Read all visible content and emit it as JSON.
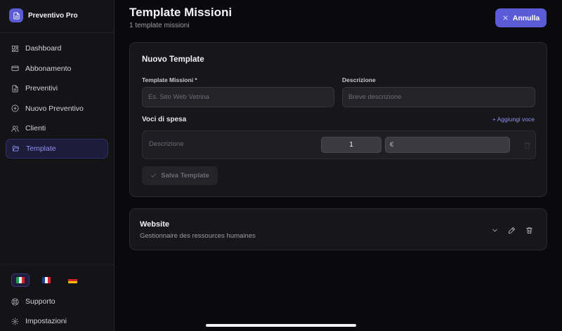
{
  "brand": {
    "name": "Preventivo Pro",
    "logo_icon": "document-icon",
    "accent": "#5b5bd6"
  },
  "sidebar": {
    "items": [
      {
        "label": "Dashboard",
        "icon": "dashboard-grid-icon",
        "active": false
      },
      {
        "label": "Abbonamento",
        "icon": "credit-card-icon",
        "active": false
      },
      {
        "label": "Preventivi",
        "icon": "document-icon",
        "active": false
      },
      {
        "label": "Nuovo Preventivo",
        "icon": "plus-circle-icon",
        "active": false
      },
      {
        "label": "Clienti",
        "icon": "users-icon",
        "active": false
      },
      {
        "label": "Template",
        "icon": "folder-open-icon",
        "active": true
      }
    ],
    "languages": [
      {
        "code": "it",
        "flag": "italy-flag-icon",
        "active": true
      },
      {
        "code": "fr",
        "flag": "france-flag-icon",
        "active": false
      },
      {
        "code": "de",
        "flag": "germany-flag-icon",
        "active": false
      }
    ],
    "support_label": "Supporto",
    "settings_label": "Impostazioni"
  },
  "header": {
    "title": "Template Missioni",
    "subtitle": "1 template missioni",
    "cancel_label": "Annulla"
  },
  "new_template": {
    "title": "Nuovo Template",
    "name_label": "Template Missioni *",
    "name_placeholder": "Es. Sito Web Vetrina",
    "description_label": "Descrizione",
    "description_placeholder": "Breve descrizione",
    "lines_label": "Voci di spesa",
    "add_line_label": "+ Aggiungi voce",
    "line": {
      "description_placeholder": "Descrizione",
      "quantity": "1",
      "currency": "€"
    },
    "save_label": "Salva Template"
  },
  "templates": [
    {
      "name": "Website",
      "description": "Gestionnaire des ressources humaines"
    }
  ]
}
